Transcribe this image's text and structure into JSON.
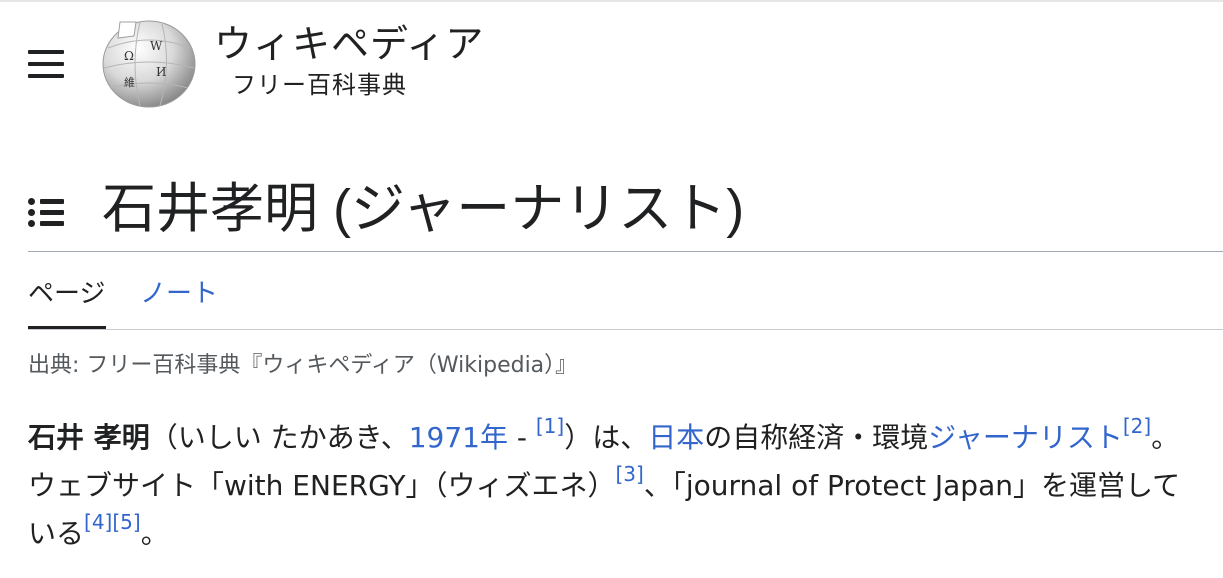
{
  "header": {
    "wordmark": "ウィキペディア",
    "tagline": "フリー百科事典",
    "globe_glyphs": [
      "Ω",
      "W",
      "維",
      "И"
    ]
  },
  "page": {
    "title": "石井孝明 (ジャーナリスト)",
    "tabs": [
      {
        "label": "ページ",
        "active": true
      },
      {
        "label": "ノート",
        "active": false
      }
    ],
    "from_line": "出典: フリー百科事典『ウィキペディア（Wikipedia）』"
  },
  "article": {
    "subject_bold": "石井 孝明",
    "reading_prefix": "（いしい たかあき、",
    "birth_year_link": "1971年",
    "dash": " - ",
    "ref1": "[1]",
    "after_ref1": "）は、",
    "country_link": "日本",
    "self_described": "の自称経済・環境",
    "profession_link": "ジャーナリスト",
    "ref2": "[2]",
    "website_sentence": "。ウェブサイト「with ENERGY」（ウィズエネ）",
    "ref3": "[3]",
    "journal_sentence": "、「journal of Protect Japan」を運営している",
    "ref4": "[4]",
    "ref5": "[5]",
    "end": "。"
  },
  "colors": {
    "text": "#202122",
    "link": "#3366cc",
    "muted": "#54595d",
    "rule": "#a2a9b1"
  },
  "icons": [
    "menu-icon",
    "wikipedia-globe-logo",
    "table-of-contents-icon"
  ]
}
